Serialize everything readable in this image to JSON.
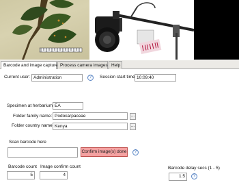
{
  "tabs": [
    {
      "label": "Barcode and image capture",
      "active": true
    },
    {
      "label": "Process camera images",
      "active": false
    },
    {
      "label": "Help",
      "active": false
    }
  ],
  "session": {
    "current_user_label": "Current user:",
    "current_user_value": "Administration",
    "start_time_label": "Session start time:",
    "start_time_value": "10:09:40"
  },
  "specimen": {
    "herbarium_label": "Specimen at herbarium",
    "herbarium_value": "EA",
    "family_label": "Folder family name:",
    "family_value": "Podocarpaceae",
    "country_label": "Folder country name:",
    "country_value": "Kenya"
  },
  "barcode": {
    "scan_label": "Scan barcode here",
    "scan_value": "",
    "confirm_label": "Confirm image(s) done",
    "count_label": "Barcode count",
    "count_value": "5",
    "image_confirm_label": "Image confirm count",
    "image_confirm_value": "4",
    "delay_label": "Barcode delay secs (1 - 5)",
    "delay_value": "1.5"
  },
  "icons": {
    "help_glyph": "?",
    "browse_glyph": "..."
  },
  "colors": {
    "confirm_button_bg": "#f4a1a1",
    "help_icon": "#3b6fb6"
  }
}
